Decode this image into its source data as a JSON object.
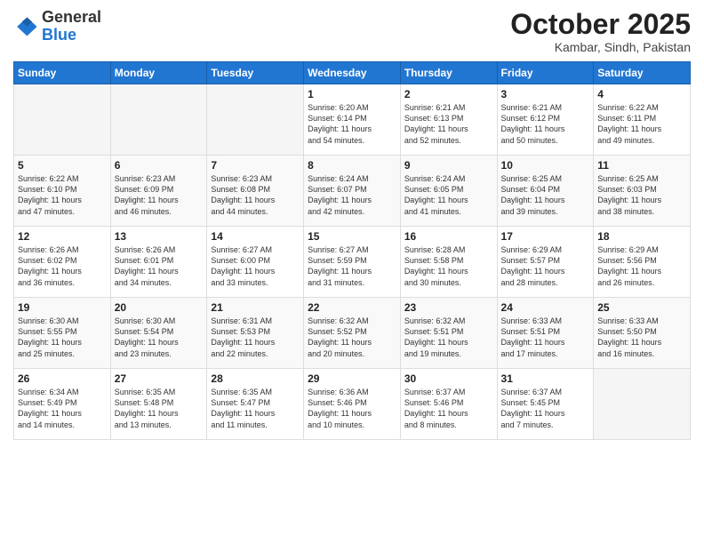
{
  "header": {
    "logo_general": "General",
    "logo_blue": "Blue",
    "month": "October 2025",
    "location": "Kambar, Sindh, Pakistan"
  },
  "days_of_week": [
    "Sunday",
    "Monday",
    "Tuesday",
    "Wednesday",
    "Thursday",
    "Friday",
    "Saturday"
  ],
  "weeks": [
    [
      {
        "day": "",
        "text": ""
      },
      {
        "day": "",
        "text": ""
      },
      {
        "day": "",
        "text": ""
      },
      {
        "day": "1",
        "text": "Sunrise: 6:20 AM\nSunset: 6:14 PM\nDaylight: 11 hours\nand 54 minutes."
      },
      {
        "day": "2",
        "text": "Sunrise: 6:21 AM\nSunset: 6:13 PM\nDaylight: 11 hours\nand 52 minutes."
      },
      {
        "day": "3",
        "text": "Sunrise: 6:21 AM\nSunset: 6:12 PM\nDaylight: 11 hours\nand 50 minutes."
      },
      {
        "day": "4",
        "text": "Sunrise: 6:22 AM\nSunset: 6:11 PM\nDaylight: 11 hours\nand 49 minutes."
      }
    ],
    [
      {
        "day": "5",
        "text": "Sunrise: 6:22 AM\nSunset: 6:10 PM\nDaylight: 11 hours\nand 47 minutes."
      },
      {
        "day": "6",
        "text": "Sunrise: 6:23 AM\nSunset: 6:09 PM\nDaylight: 11 hours\nand 46 minutes."
      },
      {
        "day": "7",
        "text": "Sunrise: 6:23 AM\nSunset: 6:08 PM\nDaylight: 11 hours\nand 44 minutes."
      },
      {
        "day": "8",
        "text": "Sunrise: 6:24 AM\nSunset: 6:07 PM\nDaylight: 11 hours\nand 42 minutes."
      },
      {
        "day": "9",
        "text": "Sunrise: 6:24 AM\nSunset: 6:05 PM\nDaylight: 11 hours\nand 41 minutes."
      },
      {
        "day": "10",
        "text": "Sunrise: 6:25 AM\nSunset: 6:04 PM\nDaylight: 11 hours\nand 39 minutes."
      },
      {
        "day": "11",
        "text": "Sunrise: 6:25 AM\nSunset: 6:03 PM\nDaylight: 11 hours\nand 38 minutes."
      }
    ],
    [
      {
        "day": "12",
        "text": "Sunrise: 6:26 AM\nSunset: 6:02 PM\nDaylight: 11 hours\nand 36 minutes."
      },
      {
        "day": "13",
        "text": "Sunrise: 6:26 AM\nSunset: 6:01 PM\nDaylight: 11 hours\nand 34 minutes."
      },
      {
        "day": "14",
        "text": "Sunrise: 6:27 AM\nSunset: 6:00 PM\nDaylight: 11 hours\nand 33 minutes."
      },
      {
        "day": "15",
        "text": "Sunrise: 6:27 AM\nSunset: 5:59 PM\nDaylight: 11 hours\nand 31 minutes."
      },
      {
        "day": "16",
        "text": "Sunrise: 6:28 AM\nSunset: 5:58 PM\nDaylight: 11 hours\nand 30 minutes."
      },
      {
        "day": "17",
        "text": "Sunrise: 6:29 AM\nSunset: 5:57 PM\nDaylight: 11 hours\nand 28 minutes."
      },
      {
        "day": "18",
        "text": "Sunrise: 6:29 AM\nSunset: 5:56 PM\nDaylight: 11 hours\nand 26 minutes."
      }
    ],
    [
      {
        "day": "19",
        "text": "Sunrise: 6:30 AM\nSunset: 5:55 PM\nDaylight: 11 hours\nand 25 minutes."
      },
      {
        "day": "20",
        "text": "Sunrise: 6:30 AM\nSunset: 5:54 PM\nDaylight: 11 hours\nand 23 minutes."
      },
      {
        "day": "21",
        "text": "Sunrise: 6:31 AM\nSunset: 5:53 PM\nDaylight: 11 hours\nand 22 minutes."
      },
      {
        "day": "22",
        "text": "Sunrise: 6:32 AM\nSunset: 5:52 PM\nDaylight: 11 hours\nand 20 minutes."
      },
      {
        "day": "23",
        "text": "Sunrise: 6:32 AM\nSunset: 5:51 PM\nDaylight: 11 hours\nand 19 minutes."
      },
      {
        "day": "24",
        "text": "Sunrise: 6:33 AM\nSunset: 5:51 PM\nDaylight: 11 hours\nand 17 minutes."
      },
      {
        "day": "25",
        "text": "Sunrise: 6:33 AM\nSunset: 5:50 PM\nDaylight: 11 hours\nand 16 minutes."
      }
    ],
    [
      {
        "day": "26",
        "text": "Sunrise: 6:34 AM\nSunset: 5:49 PM\nDaylight: 11 hours\nand 14 minutes."
      },
      {
        "day": "27",
        "text": "Sunrise: 6:35 AM\nSunset: 5:48 PM\nDaylight: 11 hours\nand 13 minutes."
      },
      {
        "day": "28",
        "text": "Sunrise: 6:35 AM\nSunset: 5:47 PM\nDaylight: 11 hours\nand 11 minutes."
      },
      {
        "day": "29",
        "text": "Sunrise: 6:36 AM\nSunset: 5:46 PM\nDaylight: 11 hours\nand 10 minutes."
      },
      {
        "day": "30",
        "text": "Sunrise: 6:37 AM\nSunset: 5:46 PM\nDaylight: 11 hours\nand 8 minutes."
      },
      {
        "day": "31",
        "text": "Sunrise: 6:37 AM\nSunset: 5:45 PM\nDaylight: 11 hours\nand 7 minutes."
      },
      {
        "day": "",
        "text": ""
      }
    ]
  ]
}
